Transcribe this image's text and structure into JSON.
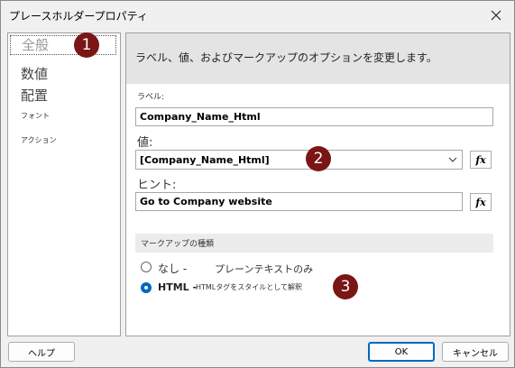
{
  "window": {
    "title": "プレースホルダープロパティ"
  },
  "sidebar": {
    "items": [
      {
        "label": "全般"
      },
      {
        "label": "数値"
      },
      {
        "label": "配置"
      },
      {
        "label": "フォント"
      },
      {
        "label": "アクション"
      }
    ]
  },
  "main": {
    "description": "ラベル、値、およびマークアップのオプションを変更します。",
    "label_caption": "ラベル:",
    "label_value": "Company_Name_Html",
    "value_caption": "値:",
    "value_value": "[Company_Name_Html]",
    "hint_caption": "ヒント:",
    "hint_value": "Go to Company website",
    "fx_label": "fx",
    "markup_section": "マークアップの種類",
    "markup_options": [
      {
        "label": "なし - ",
        "desc": "プレーンテキストのみ",
        "selected": false
      },
      {
        "label": "HTML - ",
        "desc": "HTMLタグをスタイルとして解釈",
        "selected": true
      }
    ]
  },
  "footer": {
    "help": "ヘルプ",
    "ok": "OK",
    "cancel": "キャンセル"
  },
  "callouts": [
    "1",
    "2",
    "3"
  ],
  "colors": {
    "accent": "#0067c0",
    "callout": "#7a1616"
  }
}
